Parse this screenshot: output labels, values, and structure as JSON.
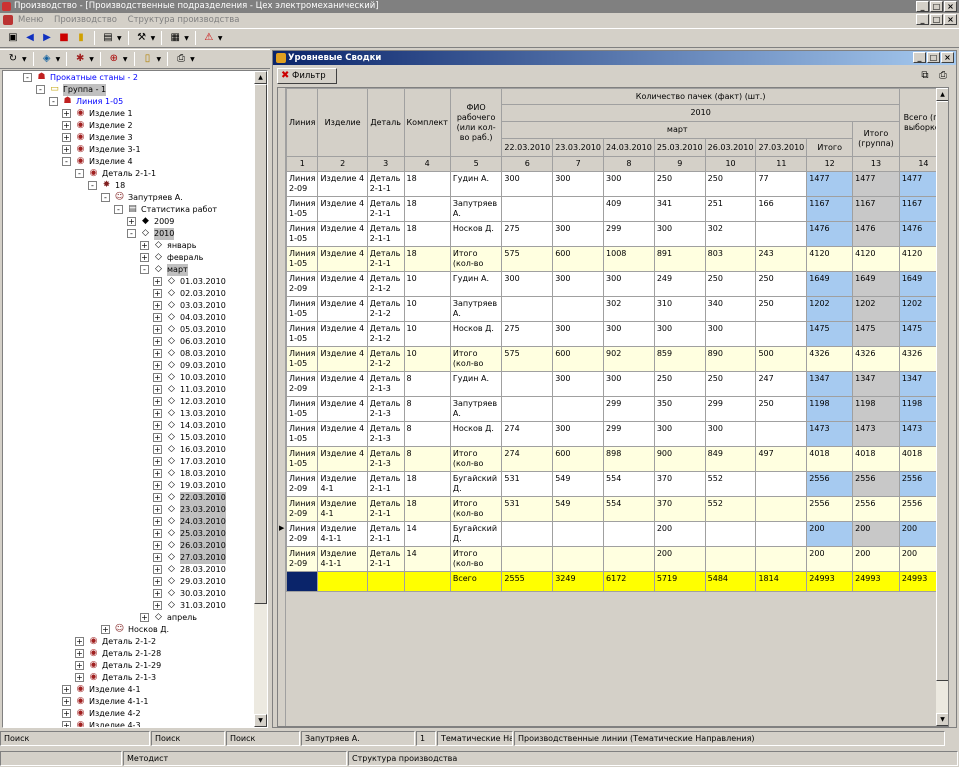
{
  "window": {
    "title": "Производство - [Производственные подразделения - Цех электромеханический]"
  },
  "menu": [
    "Меню",
    "Производство",
    "Структура производства"
  ],
  "tree": [
    {
      "label": "Прокатные станы - 2",
      "lvl": 2,
      "exp": "-",
      "icon": "group-icon",
      "blue": true
    },
    {
      "label": "Группа - 1",
      "lvl": 3,
      "exp": "-",
      "icon": "folder-icon",
      "sel": true
    },
    {
      "label": "Линия 1-05",
      "lvl": 4,
      "exp": "-",
      "icon": "line-icon",
      "blue": true
    },
    {
      "label": "Изделие 1",
      "lvl": 5,
      "exp": "+",
      "icon": "part-icon"
    },
    {
      "label": "Изделие 2",
      "lvl": 5,
      "exp": "+",
      "icon": "part-icon"
    },
    {
      "label": "Изделие 3",
      "lvl": 5,
      "exp": "+",
      "icon": "part-icon"
    },
    {
      "label": "Изделие 3-1",
      "lvl": 5,
      "exp": "+",
      "icon": "part-icon"
    },
    {
      "label": "Изделие 4",
      "lvl": 5,
      "exp": "-",
      "icon": "part-icon"
    },
    {
      "label": "Деталь 2-1-1",
      "lvl": 6,
      "exp": "-",
      "icon": "part-icon"
    },
    {
      "label": "18",
      "lvl": 7,
      "exp": "-",
      "icon": "kit-icon"
    },
    {
      "label": "Запутряев А.",
      "lvl": 8,
      "exp": "-",
      "icon": "worker-icon"
    },
    {
      "label": "Статистика работ",
      "lvl": 9,
      "exp": "-",
      "icon": "doc-icon"
    },
    {
      "label": "2009",
      "lvl": 10,
      "exp": "+",
      "icon": "diamond-filled-icon"
    },
    {
      "label": "2010",
      "lvl": 10,
      "exp": "-",
      "icon": "diamond-icon",
      "sel": true
    },
    {
      "label": "январь",
      "lvl": 11,
      "exp": "+",
      "icon": "diamond-icon"
    },
    {
      "label": "февраль",
      "lvl": 11,
      "exp": "+",
      "icon": "diamond-icon"
    },
    {
      "label": "март",
      "lvl": 11,
      "exp": "-",
      "icon": "diamond-icon",
      "sel": true
    },
    {
      "label": "01.03.2010",
      "lvl": 12,
      "exp": "+",
      "icon": "diamond-icon"
    },
    {
      "label": "02.03.2010",
      "lvl": 12,
      "exp": "+",
      "icon": "diamond-icon"
    },
    {
      "label": "03.03.2010",
      "lvl": 12,
      "exp": "+",
      "icon": "diamond-icon"
    },
    {
      "label": "04.03.2010",
      "lvl": 12,
      "exp": "+",
      "icon": "diamond-icon"
    },
    {
      "label": "05.03.2010",
      "lvl": 12,
      "exp": "+",
      "icon": "diamond-icon"
    },
    {
      "label": "06.03.2010",
      "lvl": 12,
      "exp": "+",
      "icon": "diamond-icon"
    },
    {
      "label": "08.03.2010",
      "lvl": 12,
      "exp": "+",
      "icon": "diamond-icon"
    },
    {
      "label": "09.03.2010",
      "lvl": 12,
      "exp": "+",
      "icon": "diamond-icon"
    },
    {
      "label": "10.03.2010",
      "lvl": 12,
      "exp": "+",
      "icon": "diamond-icon"
    },
    {
      "label": "11.03.2010",
      "lvl": 12,
      "exp": "+",
      "icon": "diamond-icon"
    },
    {
      "label": "12.03.2010",
      "lvl": 12,
      "exp": "+",
      "icon": "diamond-icon"
    },
    {
      "label": "13.03.2010",
      "lvl": 12,
      "exp": "+",
      "icon": "diamond-icon"
    },
    {
      "label": "14.03.2010",
      "lvl": 12,
      "exp": "+",
      "icon": "diamond-icon"
    },
    {
      "label": "15.03.2010",
      "lvl": 12,
      "exp": "+",
      "icon": "diamond-icon"
    },
    {
      "label": "16.03.2010",
      "lvl": 12,
      "exp": "+",
      "icon": "diamond-icon"
    },
    {
      "label": "17.03.2010",
      "lvl": 12,
      "exp": "+",
      "icon": "diamond-icon"
    },
    {
      "label": "18.03.2010",
      "lvl": 12,
      "exp": "+",
      "icon": "diamond-icon"
    },
    {
      "label": "19.03.2010",
      "lvl": 12,
      "exp": "+",
      "icon": "diamond-icon"
    },
    {
      "label": "22.03.2010",
      "lvl": 12,
      "exp": "+",
      "icon": "diamond-icon",
      "sel": true
    },
    {
      "label": "23.03.2010",
      "lvl": 12,
      "exp": "+",
      "icon": "diamond-icon",
      "sel": true
    },
    {
      "label": "24.03.2010",
      "lvl": 12,
      "exp": "+",
      "icon": "diamond-icon",
      "sel": true
    },
    {
      "label": "25.03.2010",
      "lvl": 12,
      "exp": "+",
      "icon": "diamond-icon",
      "sel": true
    },
    {
      "label": "26.03.2010",
      "lvl": 12,
      "exp": "+",
      "icon": "diamond-icon",
      "sel": true
    },
    {
      "label": "27.03.2010",
      "lvl": 12,
      "exp": "+",
      "icon": "diamond-icon",
      "sel": true
    },
    {
      "label": "28.03.2010",
      "lvl": 12,
      "exp": "+",
      "icon": "diamond-icon"
    },
    {
      "label": "29.03.2010",
      "lvl": 12,
      "exp": "+",
      "icon": "diamond-icon"
    },
    {
      "label": "30.03.2010",
      "lvl": 12,
      "exp": "+",
      "icon": "diamond-icon"
    },
    {
      "label": "31.03.2010",
      "lvl": 12,
      "exp": "+",
      "icon": "diamond-icon"
    },
    {
      "label": "апрель",
      "lvl": 11,
      "exp": "+",
      "icon": "diamond-icon"
    },
    {
      "label": "Носков Д.",
      "lvl": 8,
      "exp": "+",
      "icon": "worker-icon"
    },
    {
      "label": "Деталь 2-1-2",
      "lvl": 6,
      "exp": "+",
      "icon": "part-icon"
    },
    {
      "label": "Деталь 2-1-28",
      "lvl": 6,
      "exp": "+",
      "icon": "part-icon"
    },
    {
      "label": "Деталь 2-1-29",
      "lvl": 6,
      "exp": "+",
      "icon": "part-icon"
    },
    {
      "label": "Деталь 2-1-3",
      "lvl": 6,
      "exp": "+",
      "icon": "part-icon"
    },
    {
      "label": "Изделие 4-1",
      "lvl": 5,
      "exp": "+",
      "icon": "part-icon"
    },
    {
      "label": "Изделие 4-1-1",
      "lvl": 5,
      "exp": "+",
      "icon": "part-icon"
    },
    {
      "label": "Изделие 4-2",
      "lvl": 5,
      "exp": "+",
      "icon": "part-icon"
    },
    {
      "label": "Изделие 4-3",
      "lvl": 5,
      "exp": "+",
      "icon": "part-icon"
    }
  ],
  "child": {
    "title": "Уровневые Сводки",
    "filter_label": "Фильтр"
  },
  "grid": {
    "h_top": "Количество пачек (факт) (шт.)",
    "h_year": "2010",
    "h_month": "март",
    "h_cols": [
      "Линия",
      "Изделие",
      "Деталь",
      "Комплект",
      "ФИО рабочего (или кол-во раб.)"
    ],
    "h_dates": [
      "22.03.2010",
      "23.03.2010",
      "24.03.2010",
      "25.03.2010",
      "26.03.2010",
      "27.03.2010",
      "Итого"
    ],
    "h_group": "Итого (группа)",
    "h_all": "Всего (по выборке)",
    "nums": [
      "1",
      "2",
      "3",
      "4",
      "5",
      "6",
      "7",
      "8",
      "9",
      "10",
      "11",
      "12",
      "13",
      "14"
    ],
    "rows": [
      [
        "Линия 2-09",
        "Изделие 4",
        "Деталь 2-1-1",
        "18",
        "Гудин А.",
        "300",
        "300",
        "300",
        "250",
        "250",
        "77",
        "1477",
        "1477",
        "1477"
      ],
      [
        "Линия 1-05",
        "Изделие 4",
        "Деталь 2-1-1",
        "18",
        "Запутряев А.",
        "",
        "",
        "409",
        "341",
        "251",
        "166",
        "1167",
        "1167",
        "1167"
      ],
      [
        "Линия 1-05",
        "Изделие 4",
        "Деталь 2-1-1",
        "18",
        "Носков Д.",
        "275",
        "300",
        "299",
        "300",
        "302",
        "",
        "1476",
        "1476",
        "1476"
      ],
      [
        "Линия 1-05",
        "Изделие 4",
        "Деталь 2-1-1",
        "18",
        "Итого (кол-во",
        "575",
        "600",
        "1008",
        "891",
        "803",
        "243",
        "4120",
        "4120",
        "4120"
      ],
      [
        "Линия 2-09",
        "Изделие 4",
        "Деталь 2-1-2",
        "10",
        "Гудин А.",
        "300",
        "300",
        "300",
        "249",
        "250",
        "250",
        "1649",
        "1649",
        "1649"
      ],
      [
        "Линия 1-05",
        "Изделие 4",
        "Деталь 2-1-2",
        "10",
        "Запутряев А.",
        "",
        "",
        "302",
        "310",
        "340",
        "250",
        "1202",
        "1202",
        "1202"
      ],
      [
        "Линия 1-05",
        "Изделие 4",
        "Деталь 2-1-2",
        "10",
        "Носков Д.",
        "275",
        "300",
        "300",
        "300",
        "300",
        "",
        "1475",
        "1475",
        "1475"
      ],
      [
        "Линия 1-05",
        "Изделие 4",
        "Деталь 2-1-2",
        "10",
        "Итого (кол-во",
        "575",
        "600",
        "902",
        "859",
        "890",
        "500",
        "4326",
        "4326",
        "4326"
      ],
      [
        "Линия 2-09",
        "Изделие 4",
        "Деталь 2-1-3",
        "8",
        "Гудин А.",
        "",
        "300",
        "300",
        "250",
        "250",
        "247",
        "1347",
        "1347",
        "1347"
      ],
      [
        "Линия 1-05",
        "Изделие 4",
        "Деталь 2-1-3",
        "8",
        "Запутряев А.",
        "",
        "",
        "299",
        "350",
        "299",
        "250",
        "1198",
        "1198",
        "1198"
      ],
      [
        "Линия 1-05",
        "Изделие 4",
        "Деталь 2-1-3",
        "8",
        "Носков Д.",
        "274",
        "300",
        "299",
        "300",
        "300",
        "",
        "1473",
        "1473",
        "1473"
      ],
      [
        "Линия 1-05",
        "Изделие 4",
        "Деталь 2-1-3",
        "8",
        "Итого (кол-во",
        "274",
        "600",
        "898",
        "900",
        "849",
        "497",
        "4018",
        "4018",
        "4018"
      ],
      [
        "Линия 2-09",
        "Изделие 4-1",
        "Деталь 2-1-1",
        "18",
        "Бугайский Д.",
        "531",
        "549",
        "554",
        "370",
        "552",
        "",
        "2556",
        "2556",
        "2556"
      ],
      [
        "Линия 2-09",
        "Изделие 4-1",
        "Деталь 2-1-1",
        "18",
        "Итого (кол-во",
        "531",
        "549",
        "554",
        "370",
        "552",
        "",
        "2556",
        "2556",
        "2556"
      ],
      [
        "Линия 2-09",
        "Изделие 4-1-1",
        "Деталь 2-1-1",
        "14",
        "Бугайский Д.",
        "",
        "",
        "",
        "200",
        "",
        "",
        "200",
        "200",
        "200"
      ],
      [
        "Линия 2-09",
        "Изделие 4-1-1",
        "Деталь 2-1-1",
        "14",
        "Итого (кол-во",
        "",
        "",
        "",
        "200",
        "",
        "",
        "200",
        "200",
        "200"
      ]
    ],
    "total": [
      "",
      "",
      "",
      "",
      "Всего",
      "2555",
      "3249",
      "6172",
      "5719",
      "5484",
      "1814",
      "24993",
      "24993",
      "24993"
    ]
  },
  "status1": [
    "Поиск",
    "Поиск",
    "Поиск",
    "Запутряев А.",
    "1",
    "Тематические Напр",
    "Производственные линии (Тематические Направления)"
  ],
  "status2": [
    "",
    "Методист",
    "Структура производства"
  ]
}
